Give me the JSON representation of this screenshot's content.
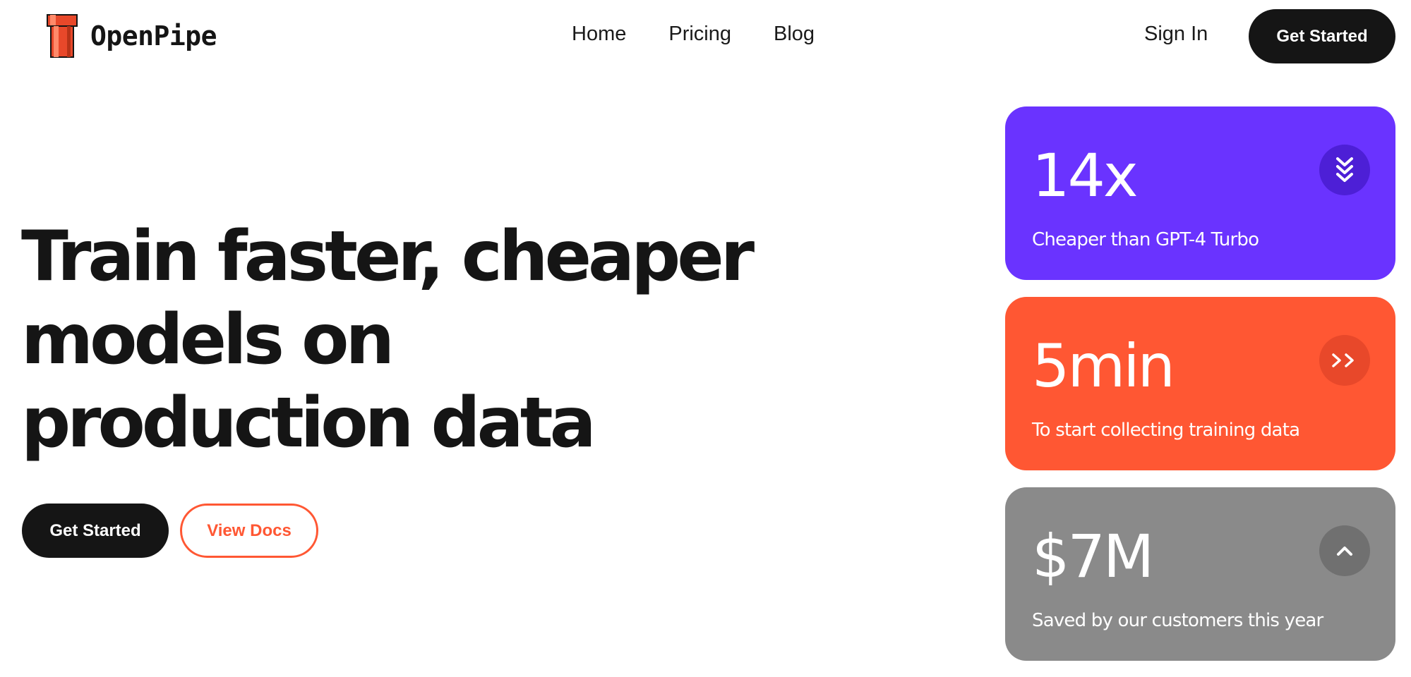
{
  "brand": {
    "name": "OpenPipe",
    "logo_icon": "pipe-icon",
    "accent_color": "#ff5733"
  },
  "nav": {
    "items": [
      {
        "label": "Home"
      },
      {
        "label": "Pricing"
      },
      {
        "label": "Blog"
      }
    ],
    "sign_in_label": "Sign In",
    "cta_label": "Get Started"
  },
  "hero": {
    "title": "Train faster, cheaper models on production data",
    "primary_button_label": "Get Started",
    "secondary_button_label": "View Docs"
  },
  "stats": [
    {
      "value": "14x",
      "caption": "Cheaper than GPT-4 Turbo",
      "icon": "double-chevron-down-icon",
      "color": "#6a33ff"
    },
    {
      "value": "5min",
      "caption": "To start collecting training data",
      "icon": "double-chevron-right-icon",
      "color": "#ff5733"
    },
    {
      "value": "$7M",
      "caption": "Saved by our customers this year",
      "icon": "chevron-up-icon",
      "color": "#8a8a8a"
    }
  ]
}
